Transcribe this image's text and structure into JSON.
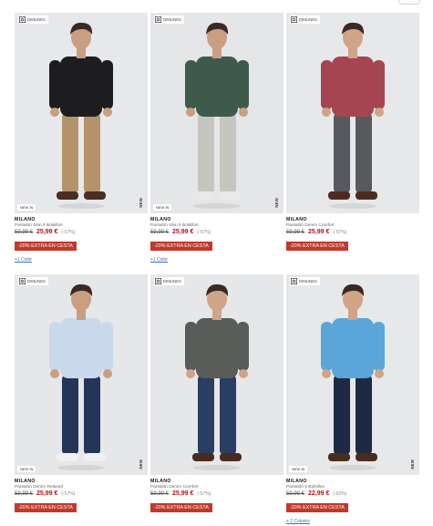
{
  "badge": {
    "dimensions_label": "DIMLINES",
    "icon": "ruler-frame-icon"
  },
  "products": [
    {
      "brand": "MILANO",
      "name": "Pantalón Slim 5 Bolsillos",
      "old_price": "59,99 €",
      "new_price": "25,99 €",
      "discount": "(-57%)",
      "promo": "-20% EXTRA EN CESTA",
      "colors": "+1 Color",
      "new_in": "NEW IN",
      "vertical_tag": "NEW",
      "bg": "#e6e8eb",
      "top": "#1d1d1f",
      "bottom": "#b4926a",
      "shoes": "#4b2e22",
      "skin": "#c89f82"
    },
    {
      "brand": "MILANO",
      "name": "Pantalón Slim 5 Bolsillos",
      "old_price": "59,99 €",
      "new_price": "25,99 €",
      "discount": "(-57%)",
      "promo": "-20% EXTRA EN CESTA",
      "colors": "+1 Color",
      "new_in": "NEW IN",
      "vertical_tag": "NEW",
      "bg": "#e4e6e8",
      "top": "#3e5a4c",
      "bottom": "#c7c5c0",
      "shoes": "#e9e9e9",
      "skin": "#c89f82"
    },
    {
      "brand": "MILANO",
      "name": "Pantalón Denim Comfort",
      "old_price": "59,99 €",
      "new_price": "25,99 €",
      "discount": "(-57%)",
      "promo": "-20% EXTRA EN CESTA",
      "colors": "",
      "new_in": "",
      "vertical_tag": "",
      "bg": "#e7e8ea",
      "top": "#a64552",
      "bottom": "#57595e",
      "shoes": "#4d2c20",
      "skin": "#cfa487"
    },
    {
      "brand": "MILANO",
      "name": "Pantalón Denim Relaxed",
      "old_price": "59,99 €",
      "new_price": "25,99 €",
      "discount": "(-57%)",
      "promo": "-20% EXTRA EN CESTA",
      "colors": "",
      "new_in": "NEW IN",
      "vertical_tag": "NEW",
      "bg": "#e6e7e9",
      "top": "#c9d8ea",
      "bottom": "#25355a",
      "shoes": "#f1f1f1",
      "skin": "#c89f82"
    },
    {
      "brand": "MILANO",
      "name": "Pantalón Denim Comfort",
      "old_price": "59,99 €",
      "new_price": "25,99 €",
      "discount": "(-57%)",
      "promo": "-20% EXTRA EN CESTA",
      "colors": "",
      "new_in": "",
      "vertical_tag": "",
      "bg": "#e6e7e9",
      "top": "#5a5c59",
      "bottom": "#2a3d63",
      "shoes": "#4a2b20",
      "skin": "#cfa487"
    },
    {
      "brand": "MILANO",
      "name": "Pantalón 5 Bolsillos",
      "old_price": "59,99 €",
      "new_price": "22,99 €",
      "discount": "(-62%)",
      "promo": "-20% EXTRA EN CESTA",
      "colors": "+ 2 Colores",
      "new_in": "NEW IN",
      "vertical_tag": "NEW",
      "bg": "#e7e8ea",
      "top": "#5aa6d8",
      "bottom": "#1e2a44",
      "shoes": "#4a2b20",
      "skin": "#cfa487"
    }
  ]
}
